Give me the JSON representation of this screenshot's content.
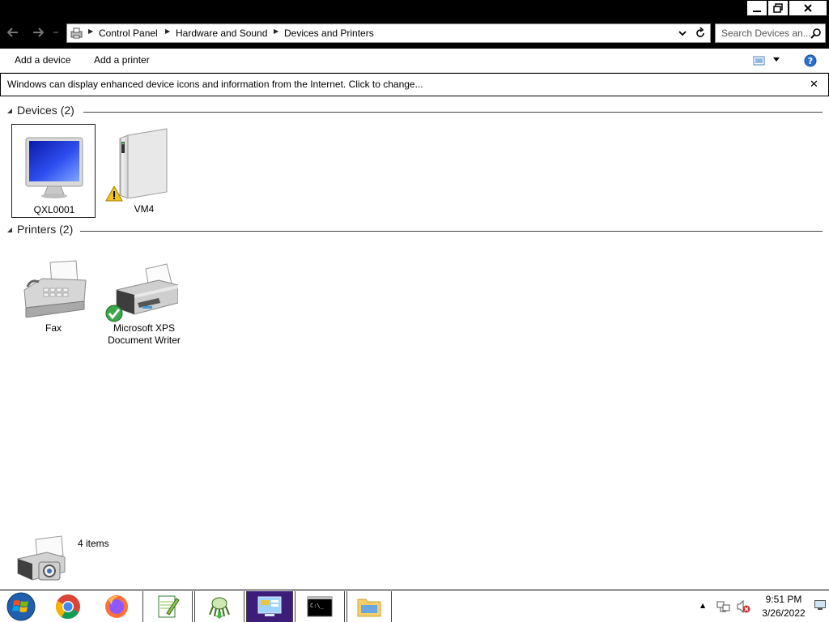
{
  "window": {
    "controls": {
      "minimize": "minimize",
      "restore": "restore",
      "close": "close"
    }
  },
  "address": {
    "crumbs": [
      "Control Panel",
      "Hardware and Sound",
      "Devices and Printers"
    ],
    "search_placeholder": "Search Devices an..."
  },
  "toolbar": {
    "add_device": "Add a device",
    "add_printer": "Add a printer"
  },
  "infobar": {
    "text": "Windows can display enhanced device icons and information from the Internet. Click to change...",
    "close": "✕"
  },
  "groups": {
    "devices": {
      "title": "Devices",
      "count": "(2)",
      "items": [
        {
          "label": "QXL0001",
          "icon": "monitor-icon",
          "selected": true
        },
        {
          "label": "VM4",
          "icon": "drive-tower-icon",
          "badge": "warning-icon"
        }
      ]
    },
    "printers": {
      "title": "Printers",
      "count": "(2)",
      "items": [
        {
          "label": "Fax",
          "icon": "fax-icon"
        },
        {
          "label_lines": [
            "Microsoft XPS",
            "Document Writer"
          ],
          "icon": "printer-icon",
          "badge": "default-check-icon"
        }
      ]
    }
  },
  "details": {
    "count": "4 items"
  },
  "taskbar": {
    "apps": [
      "start-orb",
      "chrome",
      "firefox",
      "notepad-plus",
      "gitkraken",
      "control-panel",
      "command-prompt",
      "file-explorer"
    ],
    "clock": {
      "time": "9:51 PM",
      "date": "3/26/2022"
    }
  },
  "colors": {
    "accent": "#3d1d7a",
    "titlebar": "#000000"
  }
}
